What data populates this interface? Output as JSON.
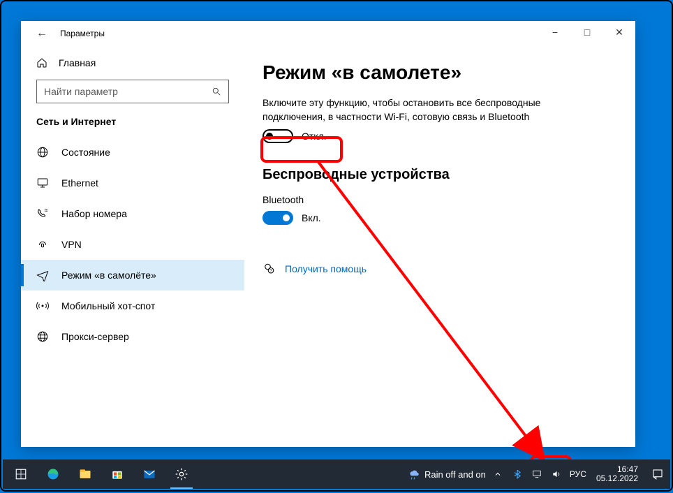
{
  "window": {
    "title": "Параметры",
    "home_label": "Главная",
    "search_placeholder": "Найти параметр",
    "section_label": "Сеть и Интернет"
  },
  "nav": [
    {
      "id": "status",
      "label": "Состояние"
    },
    {
      "id": "ethernet",
      "label": "Ethernet"
    },
    {
      "id": "dialup",
      "label": "Набор номера"
    },
    {
      "id": "vpn",
      "label": "VPN"
    },
    {
      "id": "airplane",
      "label": "Режим «в самолёте»"
    },
    {
      "id": "hotspot",
      "label": "Мобильный хот-спот"
    },
    {
      "id": "proxy",
      "label": "Прокси-сервер"
    }
  ],
  "main": {
    "heading": "Режим «в самолете»",
    "description": "Включите эту функцию, чтобы остановить все беспроводные подключения, в частности Wi-Fi, сотовую связь и Bluetooth",
    "airplane_toggle_label": "Откл.",
    "wireless_heading": "Беспроводные устройства",
    "bt_label": "Bluetooth",
    "bt_toggle_label": "Вкл.",
    "help_link": "Получить помощь"
  },
  "taskbar": {
    "weather": "Rain off and on",
    "lang": "РУС",
    "time": "16:47",
    "date": "05.12.2022"
  }
}
